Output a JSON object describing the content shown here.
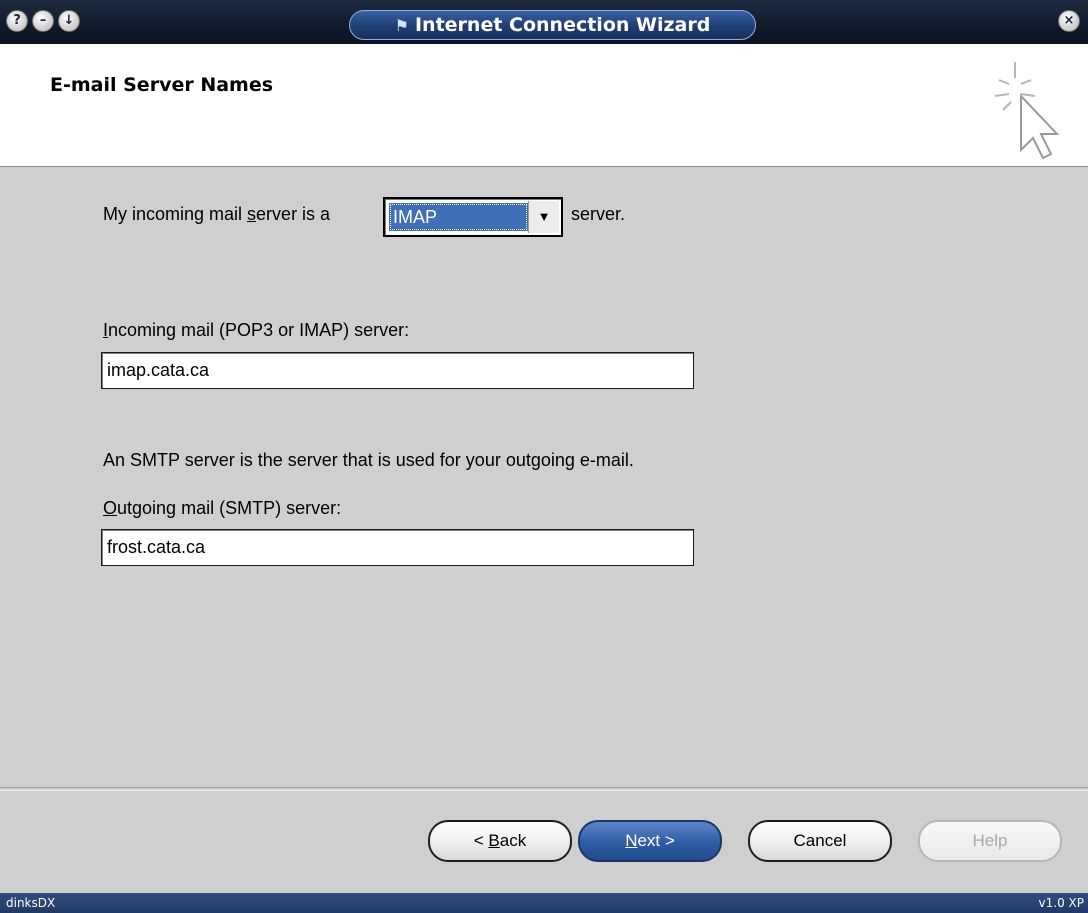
{
  "window": {
    "title": "Internet Connection Wizard",
    "title_icon": "windows-flag-icon",
    "buttons": {
      "help": "?",
      "minimize": "–",
      "restore": "↓",
      "close": "×"
    }
  },
  "header": {
    "title": "E-mail Server Names",
    "icon": "wizard-cursor-sparkle-icon"
  },
  "form": {
    "server_type_prefix": "My incoming mail ",
    "server_type_prefix_ul": "s",
    "server_type_prefix_rest": "erver is a",
    "server_type_value": "IMAP",
    "server_type_suffix": "server.",
    "incoming_label_ul": "I",
    "incoming_label_rest": "ncoming mail (POP3 or IMAP) server:",
    "incoming_value": "imap.cata.ca",
    "smtp_note": "An SMTP server is the server that is used for your outgoing e-mail.",
    "outgoing_label_ul": "O",
    "outgoing_label_rest": "utgoing mail (SMTP) server:",
    "outgoing_value": "frost.cata.ca"
  },
  "buttons": {
    "back_pre": "< ",
    "back_ul": "B",
    "back_rest": "ack",
    "next_ul": "N",
    "next_rest": "ext >",
    "cancel": "Cancel",
    "help": "Help"
  },
  "statusbar": {
    "left": "dinksDX",
    "right": "v1.0 XP"
  },
  "colors": {
    "accent": "#2e5ba4",
    "titlebar": "#101a2b"
  }
}
